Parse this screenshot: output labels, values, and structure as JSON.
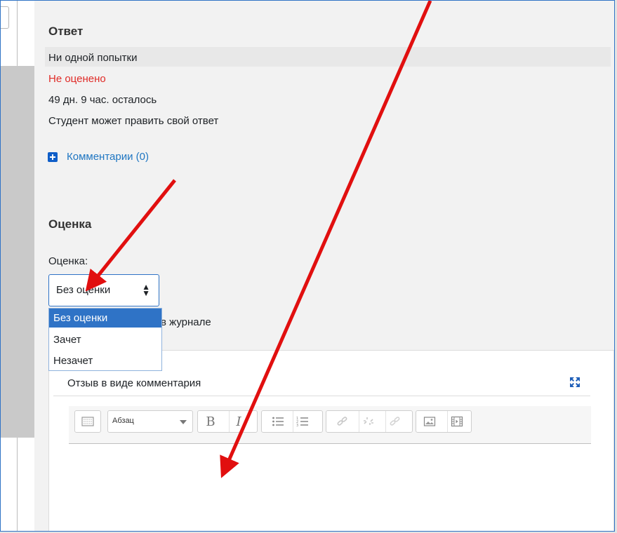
{
  "answer": {
    "heading": "Ответ",
    "attempts": "Ни одной попытки",
    "grading_status": "Не оценено",
    "time_left": "49 дн. 9 час. осталось",
    "can_edit": "Студент может править свой ответ",
    "comments_link": "Комментарии (0)"
  },
  "grade": {
    "heading": "Оценка",
    "field_label": "Оценка:",
    "selected": "Без оценки",
    "options": [
      "Без оценки",
      "Зачет",
      "Незачет"
    ],
    "gradebook_text": "в журнале"
  },
  "feedback": {
    "label": "Отзыв в виде комментария",
    "format_value": "Абзац"
  },
  "colors": {
    "accent": "#2f73c6",
    "status_red": "#e02b27",
    "link": "#1f76c2",
    "annotation_arrow": "#e10f0f"
  },
  "icons": {
    "toolbar": [
      "toolbar-toggle-icon",
      "bold-icon",
      "italic-icon",
      "unordered-list-icon",
      "ordered-list-icon",
      "link-icon",
      "unlink-icon",
      "anchor-link-icon",
      "image-icon",
      "media-icon"
    ],
    "expand": "fullscreen-expand-icon",
    "comments": "plus-square-icon"
  }
}
